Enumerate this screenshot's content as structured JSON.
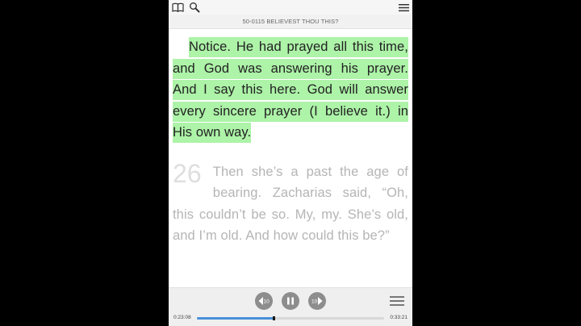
{
  "header": {
    "book_icon": "book-icon",
    "search_icon": "search-icon",
    "menu_icon": "menu-icon",
    "title": "50-0115 BELIEVEST THOU THIS?"
  },
  "content": {
    "paragraph_1": "Notice. He had prayed all this time, and God was answering his prayer. And I say this here. God will answer every sincere prayer (I believe it.) in His own way.",
    "paragraph_2_number": "26",
    "paragraph_2": "Then she’s a past the age of bearing. Zacharias said, “Oh, this couldn’t be so. My, my. She’s old, and I’m old. And how could this be?”",
    "highlight_color": "#adf3a8"
  },
  "player": {
    "rewind_label": "10",
    "forward_label": "10",
    "elapsed": "0:23:08",
    "total": "0:33:21",
    "progress": 0.41,
    "accent_color": "#4a90d9"
  }
}
